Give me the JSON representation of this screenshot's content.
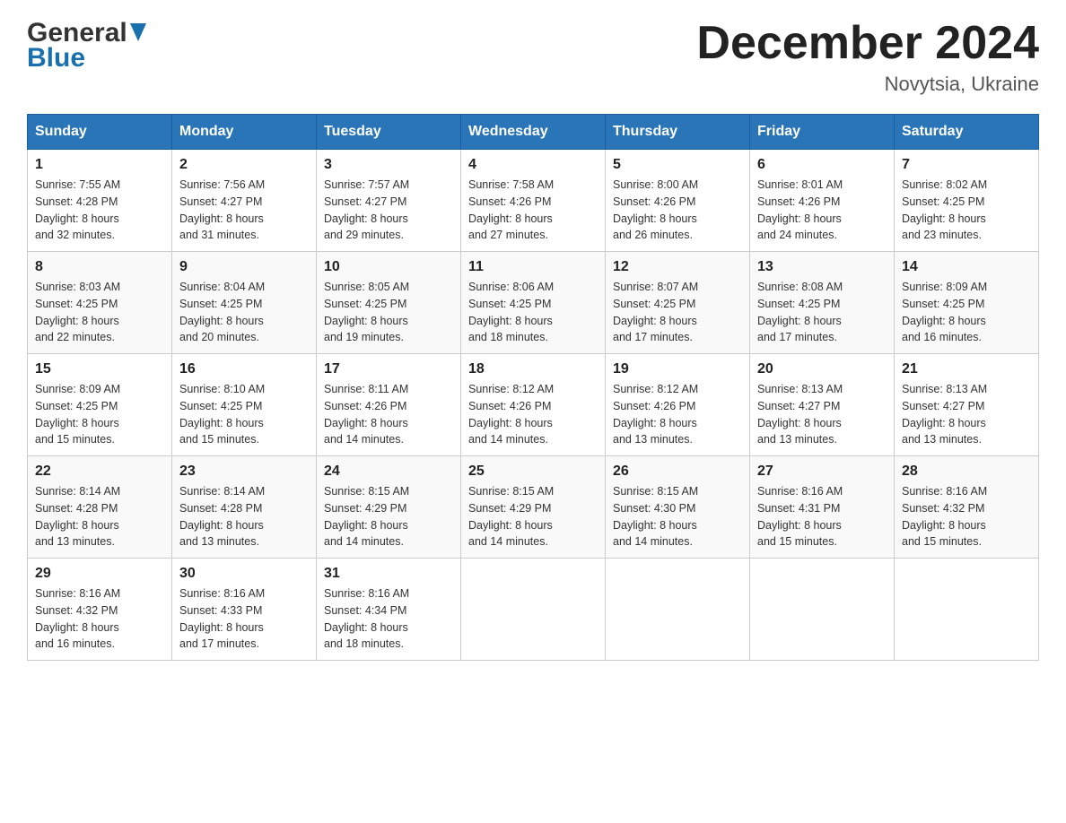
{
  "header": {
    "logo_general": "General",
    "logo_blue": "Blue",
    "month_title": "December 2024",
    "subtitle": "Novytsia, Ukraine"
  },
  "weekdays": [
    "Sunday",
    "Monday",
    "Tuesday",
    "Wednesday",
    "Thursday",
    "Friday",
    "Saturday"
  ],
  "weeks": [
    [
      {
        "day": "1",
        "info": "Sunrise: 7:55 AM\nSunset: 4:28 PM\nDaylight: 8 hours\nand 32 minutes."
      },
      {
        "day": "2",
        "info": "Sunrise: 7:56 AM\nSunset: 4:27 PM\nDaylight: 8 hours\nand 31 minutes."
      },
      {
        "day": "3",
        "info": "Sunrise: 7:57 AM\nSunset: 4:27 PM\nDaylight: 8 hours\nand 29 minutes."
      },
      {
        "day": "4",
        "info": "Sunrise: 7:58 AM\nSunset: 4:26 PM\nDaylight: 8 hours\nand 27 minutes."
      },
      {
        "day": "5",
        "info": "Sunrise: 8:00 AM\nSunset: 4:26 PM\nDaylight: 8 hours\nand 26 minutes."
      },
      {
        "day": "6",
        "info": "Sunrise: 8:01 AM\nSunset: 4:26 PM\nDaylight: 8 hours\nand 24 minutes."
      },
      {
        "day": "7",
        "info": "Sunrise: 8:02 AM\nSunset: 4:25 PM\nDaylight: 8 hours\nand 23 minutes."
      }
    ],
    [
      {
        "day": "8",
        "info": "Sunrise: 8:03 AM\nSunset: 4:25 PM\nDaylight: 8 hours\nand 22 minutes."
      },
      {
        "day": "9",
        "info": "Sunrise: 8:04 AM\nSunset: 4:25 PM\nDaylight: 8 hours\nand 20 minutes."
      },
      {
        "day": "10",
        "info": "Sunrise: 8:05 AM\nSunset: 4:25 PM\nDaylight: 8 hours\nand 19 minutes."
      },
      {
        "day": "11",
        "info": "Sunrise: 8:06 AM\nSunset: 4:25 PM\nDaylight: 8 hours\nand 18 minutes."
      },
      {
        "day": "12",
        "info": "Sunrise: 8:07 AM\nSunset: 4:25 PM\nDaylight: 8 hours\nand 17 minutes."
      },
      {
        "day": "13",
        "info": "Sunrise: 8:08 AM\nSunset: 4:25 PM\nDaylight: 8 hours\nand 17 minutes."
      },
      {
        "day": "14",
        "info": "Sunrise: 8:09 AM\nSunset: 4:25 PM\nDaylight: 8 hours\nand 16 minutes."
      }
    ],
    [
      {
        "day": "15",
        "info": "Sunrise: 8:09 AM\nSunset: 4:25 PM\nDaylight: 8 hours\nand 15 minutes."
      },
      {
        "day": "16",
        "info": "Sunrise: 8:10 AM\nSunset: 4:25 PM\nDaylight: 8 hours\nand 15 minutes."
      },
      {
        "day": "17",
        "info": "Sunrise: 8:11 AM\nSunset: 4:26 PM\nDaylight: 8 hours\nand 14 minutes."
      },
      {
        "day": "18",
        "info": "Sunrise: 8:12 AM\nSunset: 4:26 PM\nDaylight: 8 hours\nand 14 minutes."
      },
      {
        "day": "19",
        "info": "Sunrise: 8:12 AM\nSunset: 4:26 PM\nDaylight: 8 hours\nand 13 minutes."
      },
      {
        "day": "20",
        "info": "Sunrise: 8:13 AM\nSunset: 4:27 PM\nDaylight: 8 hours\nand 13 minutes."
      },
      {
        "day": "21",
        "info": "Sunrise: 8:13 AM\nSunset: 4:27 PM\nDaylight: 8 hours\nand 13 minutes."
      }
    ],
    [
      {
        "day": "22",
        "info": "Sunrise: 8:14 AM\nSunset: 4:28 PM\nDaylight: 8 hours\nand 13 minutes."
      },
      {
        "day": "23",
        "info": "Sunrise: 8:14 AM\nSunset: 4:28 PM\nDaylight: 8 hours\nand 13 minutes."
      },
      {
        "day": "24",
        "info": "Sunrise: 8:15 AM\nSunset: 4:29 PM\nDaylight: 8 hours\nand 14 minutes."
      },
      {
        "day": "25",
        "info": "Sunrise: 8:15 AM\nSunset: 4:29 PM\nDaylight: 8 hours\nand 14 minutes."
      },
      {
        "day": "26",
        "info": "Sunrise: 8:15 AM\nSunset: 4:30 PM\nDaylight: 8 hours\nand 14 minutes."
      },
      {
        "day": "27",
        "info": "Sunrise: 8:16 AM\nSunset: 4:31 PM\nDaylight: 8 hours\nand 15 minutes."
      },
      {
        "day": "28",
        "info": "Sunrise: 8:16 AM\nSunset: 4:32 PM\nDaylight: 8 hours\nand 15 minutes."
      }
    ],
    [
      {
        "day": "29",
        "info": "Sunrise: 8:16 AM\nSunset: 4:32 PM\nDaylight: 8 hours\nand 16 minutes."
      },
      {
        "day": "30",
        "info": "Sunrise: 8:16 AM\nSunset: 4:33 PM\nDaylight: 8 hours\nand 17 minutes."
      },
      {
        "day": "31",
        "info": "Sunrise: 8:16 AM\nSunset: 4:34 PM\nDaylight: 8 hours\nand 18 minutes."
      },
      {
        "day": "",
        "info": ""
      },
      {
        "day": "",
        "info": ""
      },
      {
        "day": "",
        "info": ""
      },
      {
        "day": "",
        "info": ""
      }
    ]
  ]
}
